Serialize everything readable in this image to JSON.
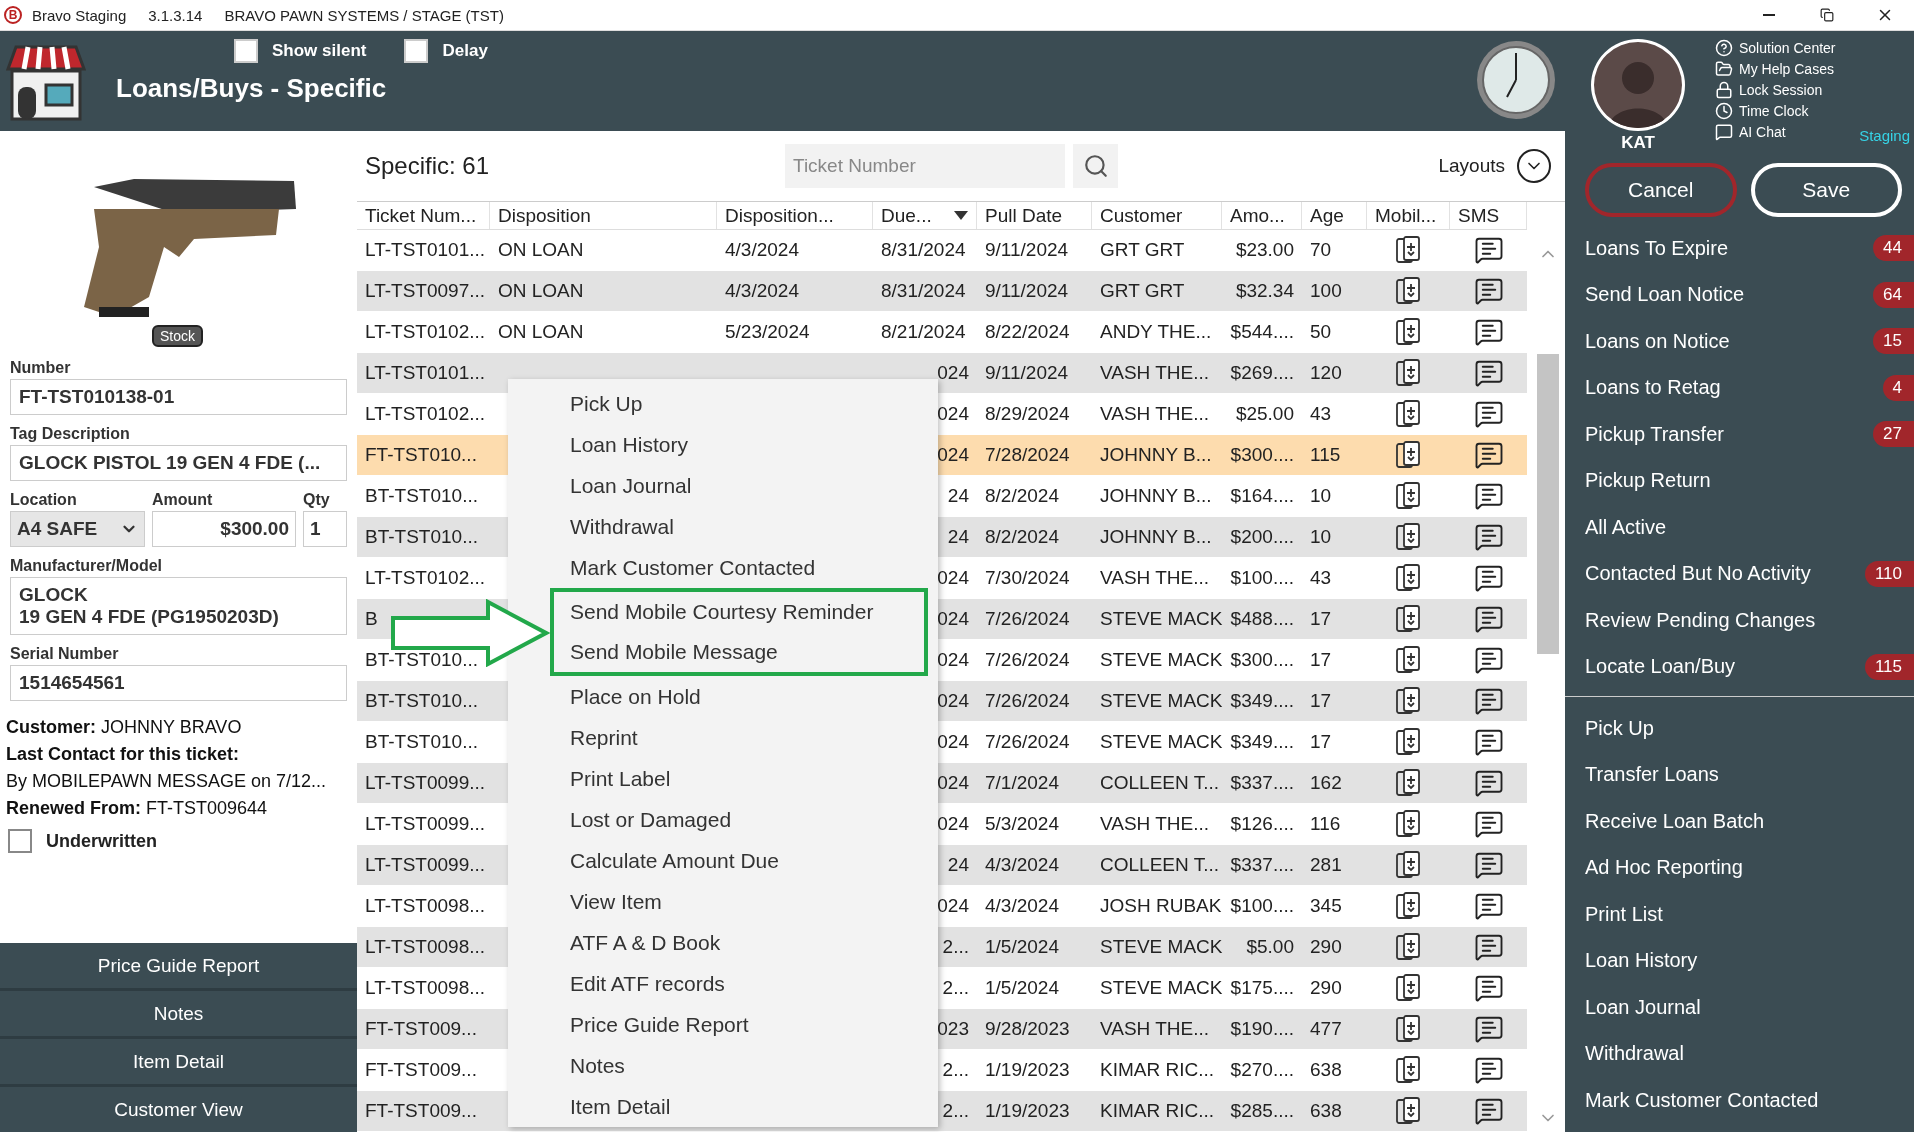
{
  "title_bar": {
    "logo_letter": "B",
    "app_name": "Bravo Staging",
    "version": "3.1.3.14",
    "system": "BRAVO PAWN SYSTEMS / STAGE (TST)"
  },
  "header": {
    "title": "Loans/Buys - Specific",
    "options": [
      {
        "label": "Show silent",
        "checked": false
      },
      {
        "label": "Delay",
        "checked": false
      }
    ]
  },
  "user": {
    "name": "KAT",
    "environment": "Staging",
    "help_links": [
      {
        "kind": "help",
        "label": "Solution Center"
      },
      {
        "kind": "folder",
        "label": "My Help Cases"
      },
      {
        "kind": "lock",
        "label": "Lock Session"
      },
      {
        "kind": "clock",
        "label": "Time Clock"
      },
      {
        "kind": "chat",
        "label": "AI Chat"
      }
    ]
  },
  "item": {
    "photo_tag": "Stock",
    "fields": [
      {
        "label": "Number",
        "value": "FT-TST010138-01"
      },
      {
        "label": "Tag Description",
        "value": "GLOCK PISTOL 19 GEN 4 FDE (..."
      }
    ],
    "location": {
      "label": "Location",
      "value": "A4 SAFE"
    },
    "amount": {
      "label": "Amount",
      "value": "$300.00"
    },
    "qty": {
      "label": "Qty",
      "value": "1"
    },
    "manufacturer": {
      "label": "Manufacturer/Model",
      "lines": [
        "GLOCK",
        "19 GEN 4 FDE (PG1950203D)"
      ]
    },
    "serial": {
      "label": "Serial Number",
      "value": "1514654561"
    },
    "customer": "**Customer:** JOHNNY BRAVO",
    "last_contact_label": "Last Contact for this ticket:",
    "last_contact": "By MOBILEPAWN MESSAGE on 7/12...",
    "renewed": "**Renewed From:** FT-TST009644",
    "underwritten": {
      "label": "Underwritten",
      "checked": false
    }
  },
  "left_buttons": [
    "Price Guide Report",
    "Notes",
    "Item Detail",
    "Customer View"
  ],
  "list": {
    "title": "Specific: 61",
    "search": {
      "placeholder": "Ticket Number"
    },
    "layouts": "Layouts",
    "columns": [
      {
        "label": "Ticket Num...",
        "sorted": false
      },
      {
        "label": "Disposition",
        "sorted": false
      },
      {
        "label": "Disposition...",
        "sorted": false
      },
      {
        "label": "Due...",
        "sorted": true
      },
      {
        "label": "Pull Date",
        "sorted": false
      },
      {
        "label": "Customer",
        "sorted": false
      },
      {
        "label": "Amo...",
        "sorted": false
      },
      {
        "label": "Age",
        "sorted": false
      },
      {
        "label": "Mobil...",
        "sorted": false
      },
      {
        "label": "SMS",
        "sorted": false
      }
    ],
    "rows": [
      {
        "ticket": "LT-TST0101...",
        "disposition": "ON LOAN",
        "disposition_date": "4/3/2024",
        "due": "8/31/2024",
        "pull_date": "9/11/2024",
        "customer": "GRT GRT",
        "amount": "$23.00",
        "age": "70",
        "selected": false
      },
      {
        "ticket": "LT-TST0097...",
        "disposition": "ON LOAN",
        "disposition_date": "4/3/2024",
        "due": "8/31/2024",
        "pull_date": "9/11/2024",
        "customer": "GRT GRT",
        "amount": "$32.34",
        "age": "100",
        "selected": false
      },
      {
        "ticket": "LT-TST0102...",
        "disposition": "ON LOAN",
        "disposition_date": "5/23/2024",
        "due": "8/21/2024",
        "pull_date": "8/22/2024",
        "customer": "ANDY THE...",
        "amount": "$544....",
        "age": "50",
        "selected": false
      },
      {
        "ticket": "LT-TST0101...",
        "due": "024",
        "pull_date": "9/11/2024",
        "customer": "VASH THE...",
        "amount": "$269....",
        "age": "120",
        "selected": false
      },
      {
        "ticket": "LT-TST0102...",
        "due": "024",
        "pull_date": "8/29/2024",
        "customer": "VASH THE...",
        "amount": "$25.00",
        "age": "43",
        "selected": false
      },
      {
        "ticket": "FT-TST010...",
        "due": "024",
        "pull_date": "7/28/2024",
        "customer": "JOHNNY B...",
        "amount": "$300....",
        "age": "115",
        "selected": true
      },
      {
        "ticket": "BT-TST010...",
        "due": "24",
        "pull_date": "8/2/2024",
        "customer": "JOHNNY B...",
        "amount": "$164....",
        "age": "10",
        "selected": false
      },
      {
        "ticket": "BT-TST010...",
        "due": "24",
        "pull_date": "8/2/2024",
        "customer": "JOHNNY B...",
        "amount": "$200....",
        "age": "10",
        "selected": false
      },
      {
        "ticket": "LT-TST0102...",
        "due": "024",
        "pull_date": "7/30/2024",
        "customer": "VASH THE...",
        "amount": "$100....",
        "age": "43",
        "selected": false
      },
      {
        "ticket": "B",
        "due": "024",
        "pull_date": "7/26/2024",
        "customer": "STEVE MACK",
        "amount": "$488....",
        "age": "17",
        "selected": false
      },
      {
        "ticket": "BT-TST010...",
        "due": "024",
        "pull_date": "7/26/2024",
        "customer": "STEVE MACK",
        "amount": "$300....",
        "age": "17",
        "selected": false
      },
      {
        "ticket": "BT-TST010...",
        "due": "024",
        "pull_date": "7/26/2024",
        "customer": "STEVE MACK",
        "amount": "$349....",
        "age": "17",
        "selected": false
      },
      {
        "ticket": "BT-TST010...",
        "due": "024",
        "pull_date": "7/26/2024",
        "customer": "STEVE MACK",
        "amount": "$349....",
        "age": "17",
        "selected": false
      },
      {
        "ticket": "LT-TST0099...",
        "due": "024",
        "pull_date": "7/1/2024",
        "customer": "COLLEEN T...",
        "amount": "$337....",
        "age": "162",
        "selected": false
      },
      {
        "ticket": "LT-TST0099...",
        "due": "024",
        "pull_date": "5/3/2024",
        "customer": "VASH THE...",
        "amount": "$126....",
        "age": "116",
        "selected": false
      },
      {
        "ticket": "LT-TST0099...",
        "due": "24",
        "pull_date": "4/3/2024",
        "customer": "COLLEEN T...",
        "amount": "$337....",
        "age": "281",
        "selected": false
      },
      {
        "ticket": "LT-TST0098...",
        "due": "024",
        "pull_date": "4/3/2024",
        "customer": "JOSH RUBAK",
        "amount": "$100....",
        "age": "345",
        "selected": false
      },
      {
        "ticket": "LT-TST0098...",
        "due": "2...",
        "pull_date": "1/5/2024",
        "customer": "STEVE MACK",
        "amount": "$5.00",
        "age": "290",
        "selected": false
      },
      {
        "ticket": "LT-TST0098...",
        "due": "2...",
        "pull_date": "1/5/2024",
        "customer": "STEVE MACK",
        "amount": "$175....",
        "age": "290",
        "selected": false
      },
      {
        "ticket": "FT-TST009...",
        "due": "023",
        "pull_date": "9/28/2023",
        "customer": "VASH THE...",
        "amount": "$190....",
        "age": "477",
        "selected": false
      },
      {
        "ticket": "FT-TST009...",
        "due": "2...",
        "pull_date": "1/19/2023",
        "customer": "KIMAR RIC...",
        "amount": "$270....",
        "age": "638",
        "selected": false
      },
      {
        "ticket": "FT-TST009...",
        "due": "2...",
        "pull_date": "1/19/2023",
        "customer": "KIMAR RIC...",
        "amount": "$285....",
        "age": "638",
        "selected": false
      }
    ]
  },
  "context_menu": [
    {
      "label": "Pick Up",
      "highlighted": false
    },
    {
      "label": "Loan History",
      "highlighted": false
    },
    {
      "label": "Loan Journal",
      "highlighted": false
    },
    {
      "label": "Withdrawal",
      "highlighted": false
    },
    {
      "label": "Mark Customer Contacted",
      "highlighted": false
    },
    {
      "label": "Send Mobile Courtesy Reminder",
      "highlighted": true
    },
    {
      "label": "Send Mobile Message",
      "highlighted": true
    },
    {
      "label": "Place on Hold",
      "highlighted": false
    },
    {
      "label": "Reprint",
      "highlighted": false
    },
    {
      "label": "Print Label",
      "highlighted": false
    },
    {
      "label": "Lost or Damaged",
      "highlighted": false
    },
    {
      "label": "Calculate Amount Due",
      "highlighted": false
    },
    {
      "label": "View Item",
      "highlighted": false
    },
    {
      "label": "ATF A & D Book",
      "highlighted": false
    },
    {
      "label": "Edit ATF records",
      "highlighted": false
    },
    {
      "label": "Price Guide Report",
      "highlighted": false
    },
    {
      "label": "Notes",
      "highlighted": false
    },
    {
      "label": "Item Detail",
      "highlighted": false
    }
  ],
  "sidebar": {
    "cancel": "Cancel",
    "save": "Save",
    "queues": [
      {
        "label": "Loans To Expire",
        "badge": "44"
      },
      {
        "label": "Send Loan Notice",
        "badge": "64"
      },
      {
        "label": "Loans on Notice",
        "badge": "15"
      },
      {
        "label": "Loans to Retag",
        "badge": "4"
      },
      {
        "label": "Pickup Transfer",
        "badge": "27"
      },
      {
        "label": "Pickup Return"
      },
      {
        "label": "All Active"
      },
      {
        "label": "Contacted But No Activity",
        "badge": "110"
      },
      {
        "label": "Review Pending Changes"
      },
      {
        "label": "Locate Loan/Buy",
        "badge": "115"
      }
    ],
    "actions": [
      "Pick Up",
      "Transfer Loans",
      "Receive Loan Batch",
      "Ad Hoc Reporting",
      "Print List",
      "Loan History",
      "Loan Journal",
      "Withdrawal",
      "Mark Customer Contacted"
    ]
  }
}
